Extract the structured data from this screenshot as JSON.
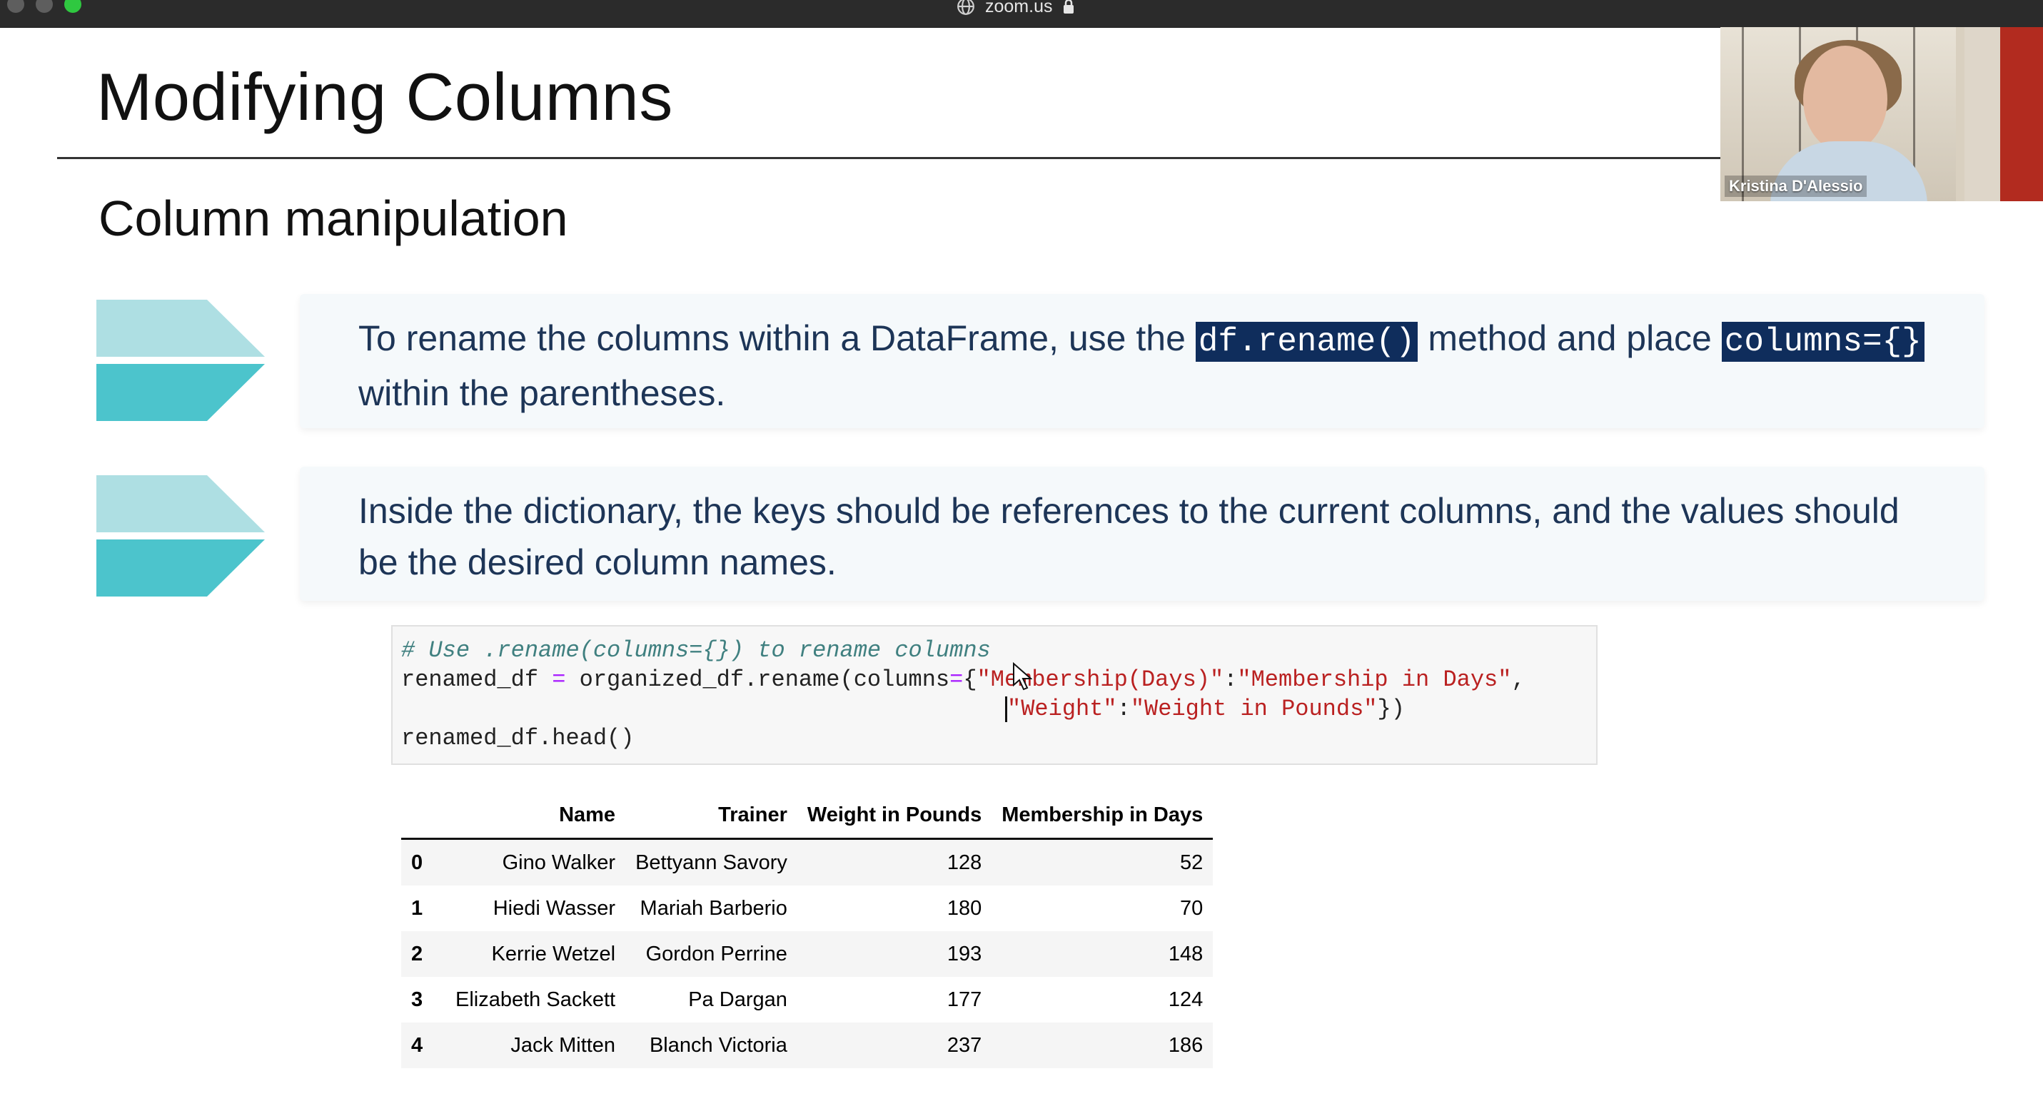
{
  "window": {
    "url_label": "zoom.us"
  },
  "slide": {
    "title": "Modifying Columns",
    "subtitle": "Column manipulation",
    "cards": [
      {
        "text_before": "To rename the columns within a DataFrame, use the ",
        "code_a": "df.rename()",
        "text_middle": " method and place ",
        "code_b": "columns={}",
        "text_after": " within the parentheses."
      },
      {
        "text": "Inside the dictionary, the keys should be references to the current columns, and the values should be the desired column names."
      }
    ]
  },
  "code_cell": {
    "line1_comment": "# Use .rename(columns={}) to rename columns",
    "line2_prefix": "renamed_df ",
    "line2_op": "=",
    "line2_mid": " organized_df.rename(columns",
    "line2_op2": "=",
    "line2_brace": "{",
    "line2_key1": "\"Membership(Days)\"",
    "line2_colon1": ":",
    "line2_val1": "\"Membership in Days\"",
    "line2_comma": ",",
    "line3_key2": "\"Weight\"",
    "line3_colon2": ":",
    "line3_val2": "\"Weight in Pounds\"",
    "line3_close": "})",
    "line4": "renamed_df.head()"
  },
  "table": {
    "columns": [
      "",
      "Name",
      "Trainer",
      "Weight in Pounds",
      "Membership in Days"
    ],
    "rows": [
      [
        "0",
        "Gino Walker",
        "Bettyann Savory",
        "128",
        "52"
      ],
      [
        "1",
        "Hiedi Wasser",
        "Mariah Barberio",
        "180",
        "70"
      ],
      [
        "2",
        "Kerrie Wetzel",
        "Gordon Perrine",
        "193",
        "148"
      ],
      [
        "3",
        "Elizabeth Sackett",
        "Pa Dargan",
        "177",
        "124"
      ],
      [
        "4",
        "Jack Mitten",
        "Blanch Victoria",
        "237",
        "186"
      ]
    ]
  },
  "video": {
    "participant_name": "Kristina D'Alessio"
  },
  "colors": {
    "accent_light": "#aedfe3",
    "accent_dark": "#4cc4cc",
    "highlight_bg": "#0f2d5c",
    "card_text": "#1d3557"
  }
}
